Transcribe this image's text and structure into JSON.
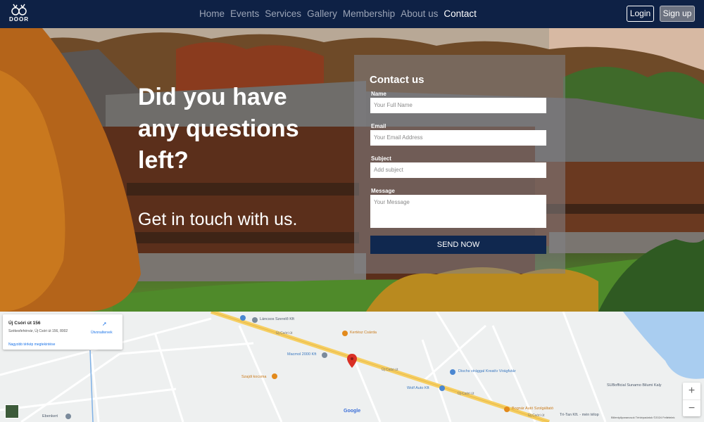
{
  "brand": {
    "logo_text": "DOOR",
    "logo_icon": "antlers-icon"
  },
  "nav": {
    "links": [
      "Home",
      "Events",
      "Services",
      "Gallery",
      "Membership",
      "About us",
      "Contact"
    ],
    "active": "Contact"
  },
  "auth": {
    "login_label": "Login",
    "signup_label": "Sign up"
  },
  "hero": {
    "title": "Did you have any questions left?",
    "subtitle": "Get in touch with us."
  },
  "contact_form": {
    "heading": "Contact us",
    "name_label": "Name",
    "name_placeholder": "Your Full Name",
    "email_label": "Email",
    "email_placeholder": "Your Email Address",
    "subject_label": "Subject",
    "subject_placeholder": "Add subject",
    "message_label": "Message",
    "message_placeholder": "Your Message",
    "submit_label": "SEND NOW"
  },
  "map": {
    "card": {
      "title": "Új Csóri út 156",
      "address": "Székesfehérvár, Új Csóri út 156, 8002",
      "directions_label": "Útvonaltervek",
      "larger_map_link": "Nagyobb térkép megtekintése"
    },
    "places": {
      "lancsos": "Láncsos Szerelő Kft",
      "kertesz": "Kertész Csárda",
      "macmol": "Macmol 2000 Kft",
      "diszko": "Dischs virággal Kreatív Virágfutár",
      "szajdi": "Szajdi kocsma",
      "wolf": "Wolf Auto Kft",
      "bognar": "Bognár Autó Szolgáltató",
      "ujcsori1": "Új Csóri út",
      "ujcsori2": "Új Csóri út",
      "ujcsori3": "Új Csóri út",
      "ujcsori4": "Új Csóri út",
      "subofficial": "SUBofficial Sunamo Bilumi Kaly",
      "tritan": "Tri-Tan Kft. - mén télop",
      "ebenkert": "Ebenkert"
    },
    "google_label": "Google",
    "footer": "Billentyűparancsok   Térképadatok ©2024   Feltételek",
    "zoom_in": "+",
    "zoom_out": "−"
  }
}
